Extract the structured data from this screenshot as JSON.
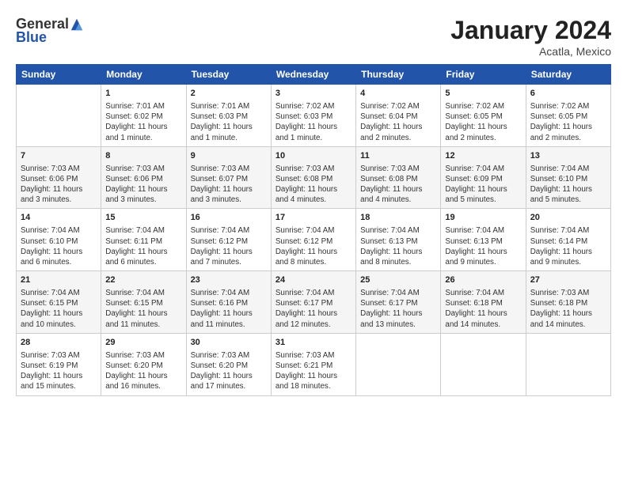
{
  "logo": {
    "general": "General",
    "blue": "Blue"
  },
  "title": "January 2024",
  "subtitle": "Acatla, Mexico",
  "days_header": [
    "Sunday",
    "Monday",
    "Tuesday",
    "Wednesday",
    "Thursday",
    "Friday",
    "Saturday"
  ],
  "weeks": [
    [
      {
        "num": "",
        "info": ""
      },
      {
        "num": "1",
        "info": "Sunrise: 7:01 AM\nSunset: 6:02 PM\nDaylight: 11 hours and 1 minute."
      },
      {
        "num": "2",
        "info": "Sunrise: 7:01 AM\nSunset: 6:03 PM\nDaylight: 11 hours and 1 minute."
      },
      {
        "num": "3",
        "info": "Sunrise: 7:02 AM\nSunset: 6:03 PM\nDaylight: 11 hours and 1 minute."
      },
      {
        "num": "4",
        "info": "Sunrise: 7:02 AM\nSunset: 6:04 PM\nDaylight: 11 hours and 2 minutes."
      },
      {
        "num": "5",
        "info": "Sunrise: 7:02 AM\nSunset: 6:05 PM\nDaylight: 11 hours and 2 minutes."
      },
      {
        "num": "6",
        "info": "Sunrise: 7:02 AM\nSunset: 6:05 PM\nDaylight: 11 hours and 2 minutes."
      }
    ],
    [
      {
        "num": "7",
        "info": "Sunrise: 7:03 AM\nSunset: 6:06 PM\nDaylight: 11 hours and 3 minutes."
      },
      {
        "num": "8",
        "info": "Sunrise: 7:03 AM\nSunset: 6:06 PM\nDaylight: 11 hours and 3 minutes."
      },
      {
        "num": "9",
        "info": "Sunrise: 7:03 AM\nSunset: 6:07 PM\nDaylight: 11 hours and 3 minutes."
      },
      {
        "num": "10",
        "info": "Sunrise: 7:03 AM\nSunset: 6:08 PM\nDaylight: 11 hours and 4 minutes."
      },
      {
        "num": "11",
        "info": "Sunrise: 7:03 AM\nSunset: 6:08 PM\nDaylight: 11 hours and 4 minutes."
      },
      {
        "num": "12",
        "info": "Sunrise: 7:04 AM\nSunset: 6:09 PM\nDaylight: 11 hours and 5 minutes."
      },
      {
        "num": "13",
        "info": "Sunrise: 7:04 AM\nSunset: 6:10 PM\nDaylight: 11 hours and 5 minutes."
      }
    ],
    [
      {
        "num": "14",
        "info": "Sunrise: 7:04 AM\nSunset: 6:10 PM\nDaylight: 11 hours and 6 minutes."
      },
      {
        "num": "15",
        "info": "Sunrise: 7:04 AM\nSunset: 6:11 PM\nDaylight: 11 hours and 6 minutes."
      },
      {
        "num": "16",
        "info": "Sunrise: 7:04 AM\nSunset: 6:12 PM\nDaylight: 11 hours and 7 minutes."
      },
      {
        "num": "17",
        "info": "Sunrise: 7:04 AM\nSunset: 6:12 PM\nDaylight: 11 hours and 8 minutes."
      },
      {
        "num": "18",
        "info": "Sunrise: 7:04 AM\nSunset: 6:13 PM\nDaylight: 11 hours and 8 minutes."
      },
      {
        "num": "19",
        "info": "Sunrise: 7:04 AM\nSunset: 6:13 PM\nDaylight: 11 hours and 9 minutes."
      },
      {
        "num": "20",
        "info": "Sunrise: 7:04 AM\nSunset: 6:14 PM\nDaylight: 11 hours and 9 minutes."
      }
    ],
    [
      {
        "num": "21",
        "info": "Sunrise: 7:04 AM\nSunset: 6:15 PM\nDaylight: 11 hours and 10 minutes."
      },
      {
        "num": "22",
        "info": "Sunrise: 7:04 AM\nSunset: 6:15 PM\nDaylight: 11 hours and 11 minutes."
      },
      {
        "num": "23",
        "info": "Sunrise: 7:04 AM\nSunset: 6:16 PM\nDaylight: 11 hours and 11 minutes."
      },
      {
        "num": "24",
        "info": "Sunrise: 7:04 AM\nSunset: 6:17 PM\nDaylight: 11 hours and 12 minutes."
      },
      {
        "num": "25",
        "info": "Sunrise: 7:04 AM\nSunset: 6:17 PM\nDaylight: 11 hours and 13 minutes."
      },
      {
        "num": "26",
        "info": "Sunrise: 7:04 AM\nSunset: 6:18 PM\nDaylight: 11 hours and 14 minutes."
      },
      {
        "num": "27",
        "info": "Sunrise: 7:03 AM\nSunset: 6:18 PM\nDaylight: 11 hours and 14 minutes."
      }
    ],
    [
      {
        "num": "28",
        "info": "Sunrise: 7:03 AM\nSunset: 6:19 PM\nDaylight: 11 hours and 15 minutes."
      },
      {
        "num": "29",
        "info": "Sunrise: 7:03 AM\nSunset: 6:20 PM\nDaylight: 11 hours and 16 minutes."
      },
      {
        "num": "30",
        "info": "Sunrise: 7:03 AM\nSunset: 6:20 PM\nDaylight: 11 hours and 17 minutes."
      },
      {
        "num": "31",
        "info": "Sunrise: 7:03 AM\nSunset: 6:21 PM\nDaylight: 11 hours and 18 minutes."
      },
      {
        "num": "",
        "info": ""
      },
      {
        "num": "",
        "info": ""
      },
      {
        "num": "",
        "info": ""
      }
    ]
  ]
}
